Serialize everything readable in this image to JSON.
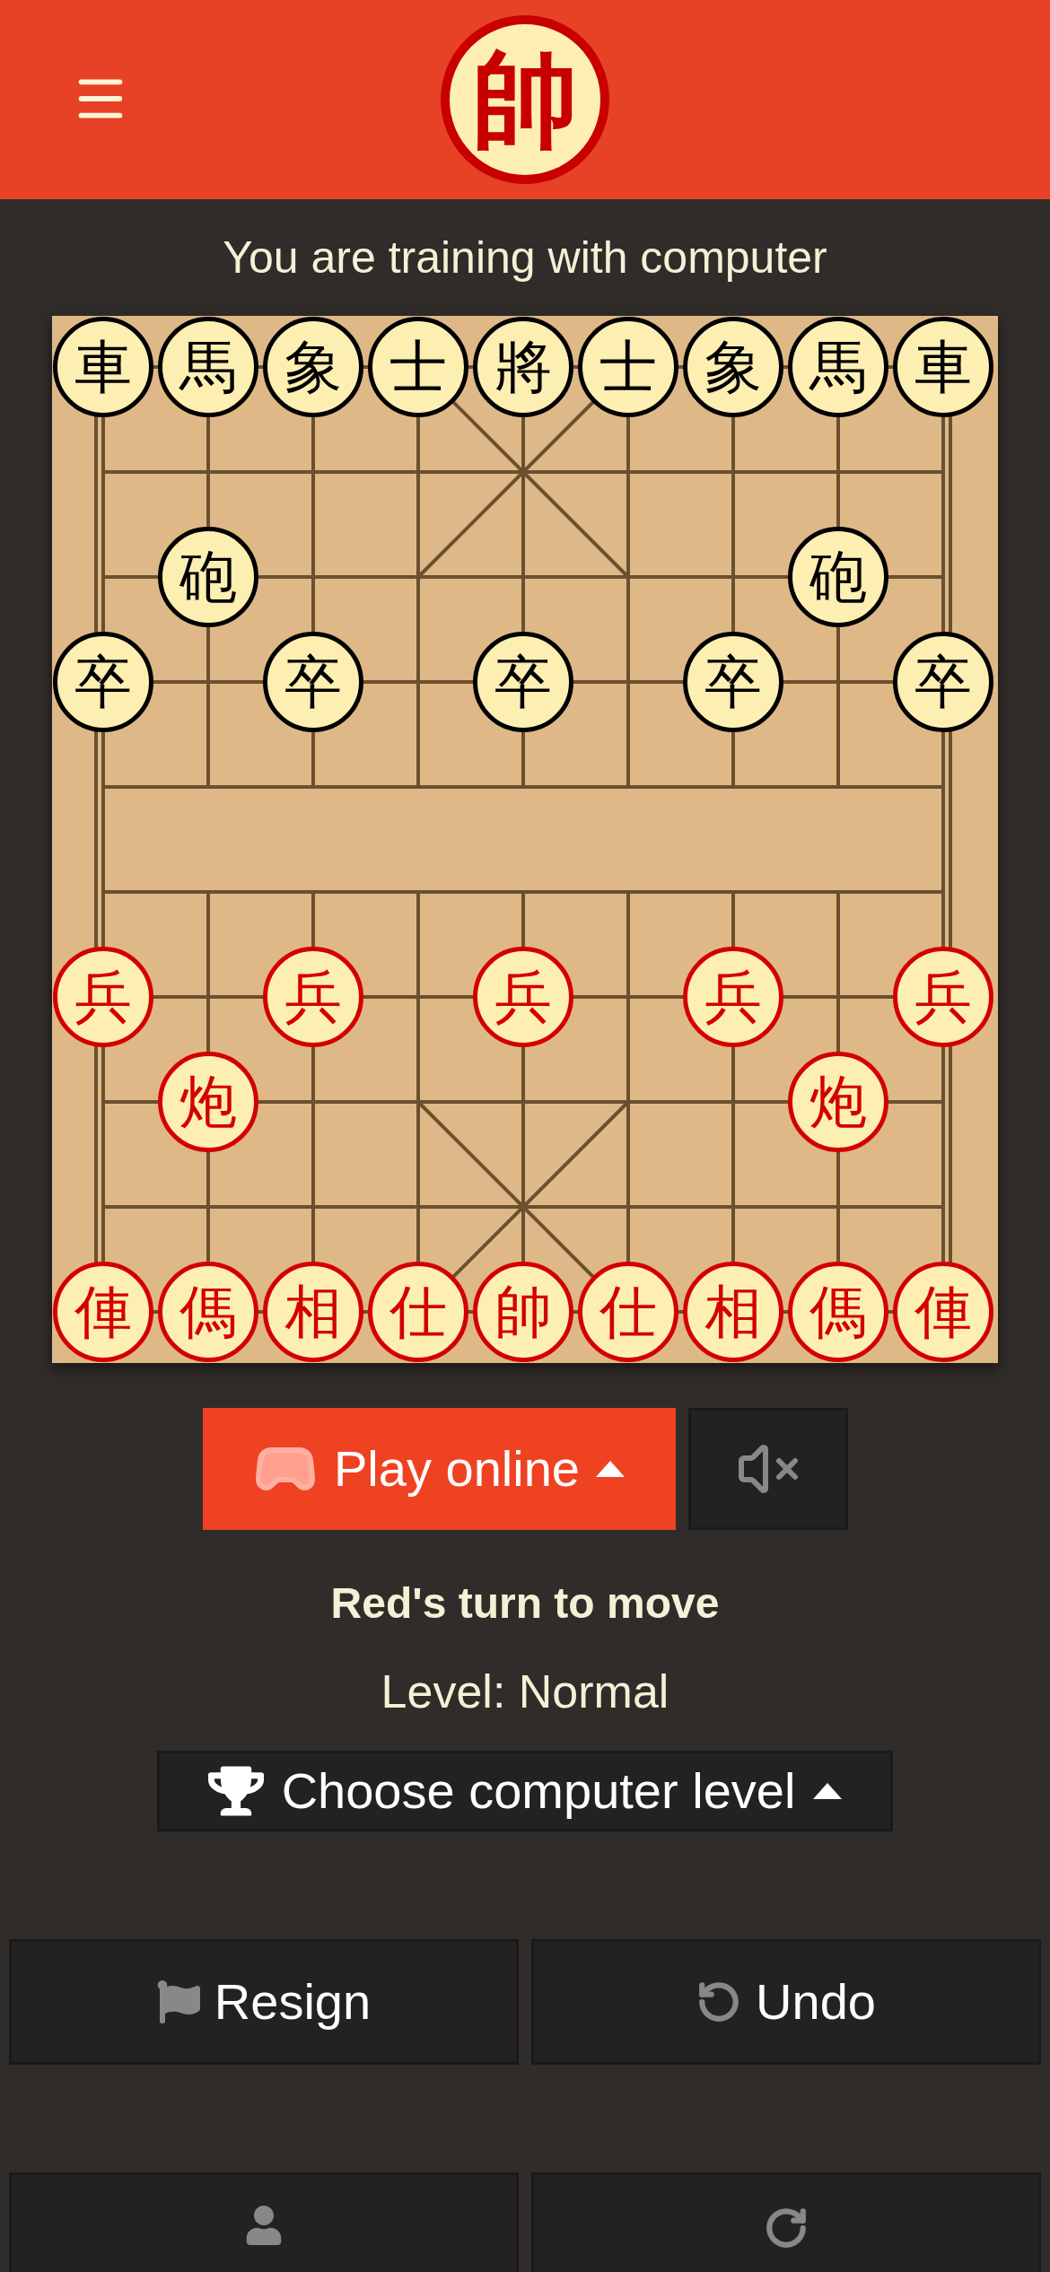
{
  "header": {
    "logo_char": "帥"
  },
  "subtitle": "You are training with computer",
  "board": {
    "ranks": [
      {
        "cells": [
          {
            "kind": "piece",
            "char": "車",
            "red": false
          },
          {
            "kind": "piece",
            "char": "馬",
            "red": false
          },
          {
            "kind": "piece",
            "char": "象",
            "red": false
          },
          {
            "kind": "piece",
            "char": "士",
            "red": false
          },
          {
            "kind": "piece",
            "char": "將",
            "red": false
          },
          {
            "kind": "piece",
            "char": "士",
            "red": false
          },
          {
            "kind": "piece",
            "char": "象",
            "red": false
          },
          {
            "kind": "piece",
            "char": "馬",
            "red": false
          },
          {
            "kind": "piece",
            "char": "車",
            "red": false
          }
        ]
      },
      {
        "cells": [
          {
            "kind": "empty"
          },
          {
            "kind": "empty"
          },
          {
            "kind": "empty"
          },
          {
            "kind": "empty"
          },
          {
            "kind": "empty"
          },
          {
            "kind": "empty"
          },
          {
            "kind": "empty"
          },
          {
            "kind": "empty"
          },
          {
            "kind": "empty"
          }
        ]
      },
      {
        "cells": [
          {
            "kind": "empty"
          },
          {
            "kind": "piece",
            "char": "砲",
            "red": false
          },
          {
            "kind": "empty"
          },
          {
            "kind": "empty"
          },
          {
            "kind": "empty"
          },
          {
            "kind": "empty"
          },
          {
            "kind": "empty"
          },
          {
            "kind": "piece",
            "char": "砲",
            "red": false
          },
          {
            "kind": "empty"
          }
        ]
      },
      {
        "cells": [
          {
            "kind": "piece",
            "char": "卒",
            "red": false
          },
          {
            "kind": "empty"
          },
          {
            "kind": "piece",
            "char": "卒",
            "red": false
          },
          {
            "kind": "empty"
          },
          {
            "kind": "piece",
            "char": "卒",
            "red": false
          },
          {
            "kind": "empty"
          },
          {
            "kind": "piece",
            "char": "卒",
            "red": false
          },
          {
            "kind": "empty"
          },
          {
            "kind": "piece",
            "char": "卒",
            "red": false
          }
        ]
      },
      {
        "cells": [
          {
            "kind": "empty"
          },
          {
            "kind": "empty"
          },
          {
            "kind": "empty"
          },
          {
            "kind": "empty"
          },
          {
            "kind": "empty"
          },
          {
            "kind": "empty"
          },
          {
            "kind": "empty"
          },
          {
            "kind": "empty"
          },
          {
            "kind": "empty"
          }
        ]
      },
      {
        "cells": [
          {
            "kind": "empty"
          },
          {
            "kind": "empty"
          },
          {
            "kind": "empty"
          },
          {
            "kind": "empty"
          },
          {
            "kind": "empty"
          },
          {
            "kind": "empty"
          },
          {
            "kind": "empty"
          },
          {
            "kind": "empty"
          },
          {
            "kind": "empty"
          }
        ]
      },
      {
        "cells": [
          {
            "kind": "piece",
            "char": "兵",
            "red": true
          },
          {
            "kind": "empty"
          },
          {
            "kind": "piece",
            "char": "兵",
            "red": true
          },
          {
            "kind": "empty"
          },
          {
            "kind": "piece",
            "char": "兵",
            "red": true
          },
          {
            "kind": "empty"
          },
          {
            "kind": "piece",
            "char": "兵",
            "red": true
          },
          {
            "kind": "empty"
          },
          {
            "kind": "piece",
            "char": "兵",
            "red": true
          }
        ]
      },
      {
        "cells": [
          {
            "kind": "empty"
          },
          {
            "kind": "piece",
            "char": "炮",
            "red": true
          },
          {
            "kind": "empty"
          },
          {
            "kind": "empty"
          },
          {
            "kind": "empty"
          },
          {
            "kind": "empty"
          },
          {
            "kind": "empty"
          },
          {
            "kind": "piece",
            "char": "炮",
            "red": true
          },
          {
            "kind": "empty"
          }
        ]
      },
      {
        "cells": [
          {
            "kind": "empty"
          },
          {
            "kind": "empty"
          },
          {
            "kind": "empty"
          },
          {
            "kind": "empty"
          },
          {
            "kind": "empty"
          },
          {
            "kind": "empty"
          },
          {
            "kind": "empty"
          },
          {
            "kind": "empty"
          },
          {
            "kind": "empty"
          }
        ]
      },
      {
        "cells": [
          {
            "kind": "piece",
            "char": "俥",
            "red": true
          },
          {
            "kind": "piece",
            "char": "傌",
            "red": true
          },
          {
            "kind": "piece",
            "char": "相",
            "red": true
          },
          {
            "kind": "piece",
            "char": "仕",
            "red": true
          },
          {
            "kind": "piece",
            "char": "帥",
            "red": true
          },
          {
            "kind": "piece",
            "char": "仕",
            "red": true
          },
          {
            "kind": "piece",
            "char": "相",
            "red": true
          },
          {
            "kind": "piece",
            "char": "傌",
            "red": true
          },
          {
            "kind": "piece",
            "char": "俥",
            "red": true
          }
        ]
      }
    ]
  },
  "play_online_button": {
    "label": "Play online"
  },
  "sound_button": {
    "muted": true
  },
  "turn_status": "Red's turn to move",
  "level_text": "Level: Normal",
  "level_button": {
    "label": "Choose computer level"
  },
  "action_buttons": [
    {
      "kind": "resign",
      "label": "Resign"
    },
    {
      "kind": "undo",
      "label": "Undo"
    }
  ],
  "cut_off_buttons": [
    {
      "kind": "person"
    },
    {
      "kind": "restart"
    }
  ]
}
